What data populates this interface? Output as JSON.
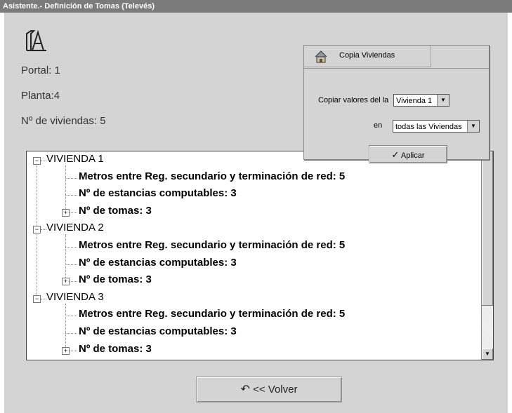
{
  "window": {
    "title": "Asistente.- Definición de Tomas  (Televés)"
  },
  "info": {
    "portal": "Portal: 1",
    "planta": "Planta:4",
    "viviendas": "Nº de viviendas: 5"
  },
  "copy_panel": {
    "title": "Copia Viviendas",
    "from_label": "Copiar valores del la",
    "from_value": "Vivienda 1",
    "to_label": "en",
    "to_value": "todas las Viviendas",
    "apply_label": "Aplicar"
  },
  "tree": {
    "viviendas": [
      {
        "label": "VIVIENDA 1",
        "metros": "Metros entre Reg. secundario y terminación de red: 5",
        "estancias": "Nº de estancias computables: 3",
        "tomas": "Nº de tomas: 3"
      },
      {
        "label": "VIVIENDA 2",
        "metros": "Metros entre Reg. secundario y terminación de red: 5",
        "estancias": "Nº de estancias computables: 3",
        "tomas": "Nº de tomas: 3"
      },
      {
        "label": "VIVIENDA 3",
        "metros": "Metros entre Reg. secundario y terminación de red: 5",
        "estancias": "Nº de estancias computables: 3",
        "tomas": "Nº de tomas: 3"
      }
    ]
  },
  "back_button": {
    "label": "<< Volver"
  },
  "icons": {
    "logo": "building-a-icon",
    "copy": "house-icon",
    "apply": "checkmark-icon",
    "back": "back-arrow-icon"
  }
}
